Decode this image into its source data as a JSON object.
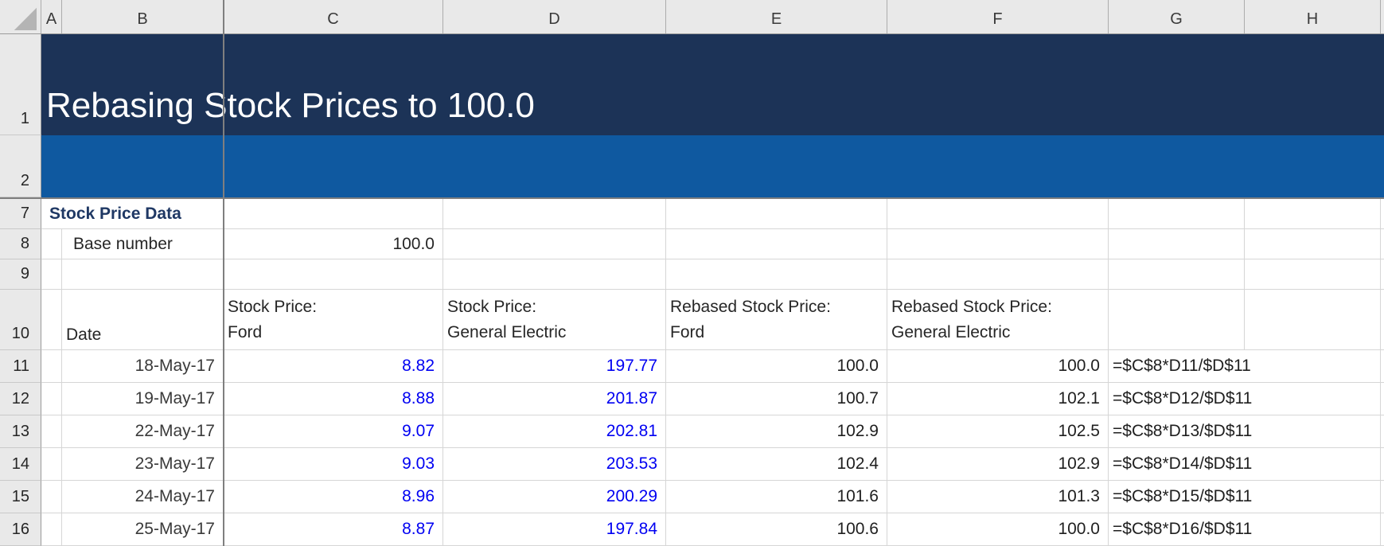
{
  "banner": {
    "title": "Rebasing Stock Prices to 100.0"
  },
  "column_headers": [
    "A",
    "B",
    "C",
    "D",
    "E",
    "F",
    "G",
    "H"
  ],
  "row_headers": [
    "1",
    "2",
    "7",
    "8",
    "9",
    "10",
    "11",
    "12",
    "13",
    "14",
    "15",
    "16"
  ],
  "section": {
    "label": "Stock Price Data"
  },
  "base": {
    "label": "Base number",
    "value": "100.0"
  },
  "table": {
    "headers": {
      "date": "Date",
      "ford_price": {
        "line1": "Stock Price:",
        "line2": "Ford"
      },
      "ge_price": {
        "line1": "Stock Price:",
        "line2": "General Electric"
      },
      "ford_rebased": {
        "line1": "Rebased Stock Price:",
        "line2": "Ford"
      },
      "ge_rebased": {
        "line1": "Rebased Stock Price:",
        "line2": "General Electric"
      }
    },
    "rows": [
      {
        "row": "11",
        "date": "18-May-17",
        "ford": "8.82",
        "ge": "197.77",
        "ford_rebased": "100.0",
        "ge_rebased": "100.0",
        "formula": "=$C$8*D11/$D$11"
      },
      {
        "row": "12",
        "date": "19-May-17",
        "ford": "8.88",
        "ge": "201.87",
        "ford_rebased": "100.7",
        "ge_rebased": "102.1",
        "formula": "=$C$8*D12/$D$11"
      },
      {
        "row": "13",
        "date": "22-May-17",
        "ford": "9.07",
        "ge": "202.81",
        "ford_rebased": "102.9",
        "ge_rebased": "102.5",
        "formula": "=$C$8*D13/$D$11"
      },
      {
        "row": "14",
        "date": "23-May-17",
        "ford": "9.03",
        "ge": "203.53",
        "ford_rebased": "102.4",
        "ge_rebased": "102.9",
        "formula": "=$C$8*D14/$D$11"
      },
      {
        "row": "15",
        "date": "24-May-17",
        "ford": "8.96",
        "ge": "200.29",
        "ford_rebased": "101.6",
        "ge_rebased": "101.3",
        "formula": "=$C$8*D15/$D$11"
      },
      {
        "row": "16",
        "date": "25-May-17",
        "ford": "8.87",
        "ge": "197.84",
        "ford_rebased": "100.6",
        "ge_rebased": "100.0",
        "formula": "=$C$8*D16/$D$11"
      }
    ]
  },
  "colors": {
    "banner_dark": "#1C3357",
    "banner_light": "#0F59A0",
    "freeze_line": "#7F7F7F",
    "gridline": "#D6D6D6",
    "header_bg": "#E9E9E9",
    "input_blue": "#0000F2",
    "section_navy": "#1F3864"
  }
}
